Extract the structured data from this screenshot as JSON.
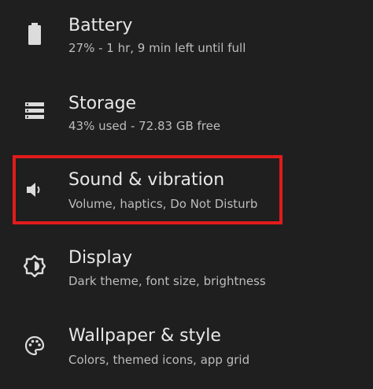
{
  "items": [
    {
      "title": "Battery",
      "subtitle": "27% - 1 hr, 9 min left until full",
      "icon": "battery-icon"
    },
    {
      "title": "Storage",
      "subtitle": "43% used - 72.83 GB free",
      "icon": "storage-icon"
    },
    {
      "title": "Sound & vibration",
      "subtitle": "Volume, haptics, Do Not Disturb",
      "icon": "volume-icon"
    },
    {
      "title": "Display",
      "subtitle": "Dark theme, font size, brightness",
      "icon": "brightness-icon"
    },
    {
      "title": "Wallpaper & style",
      "subtitle": "Colors, themed icons, app grid",
      "icon": "palette-icon"
    }
  ],
  "highlight_color": "#e21b1b",
  "background_color": "#1f1f1f"
}
